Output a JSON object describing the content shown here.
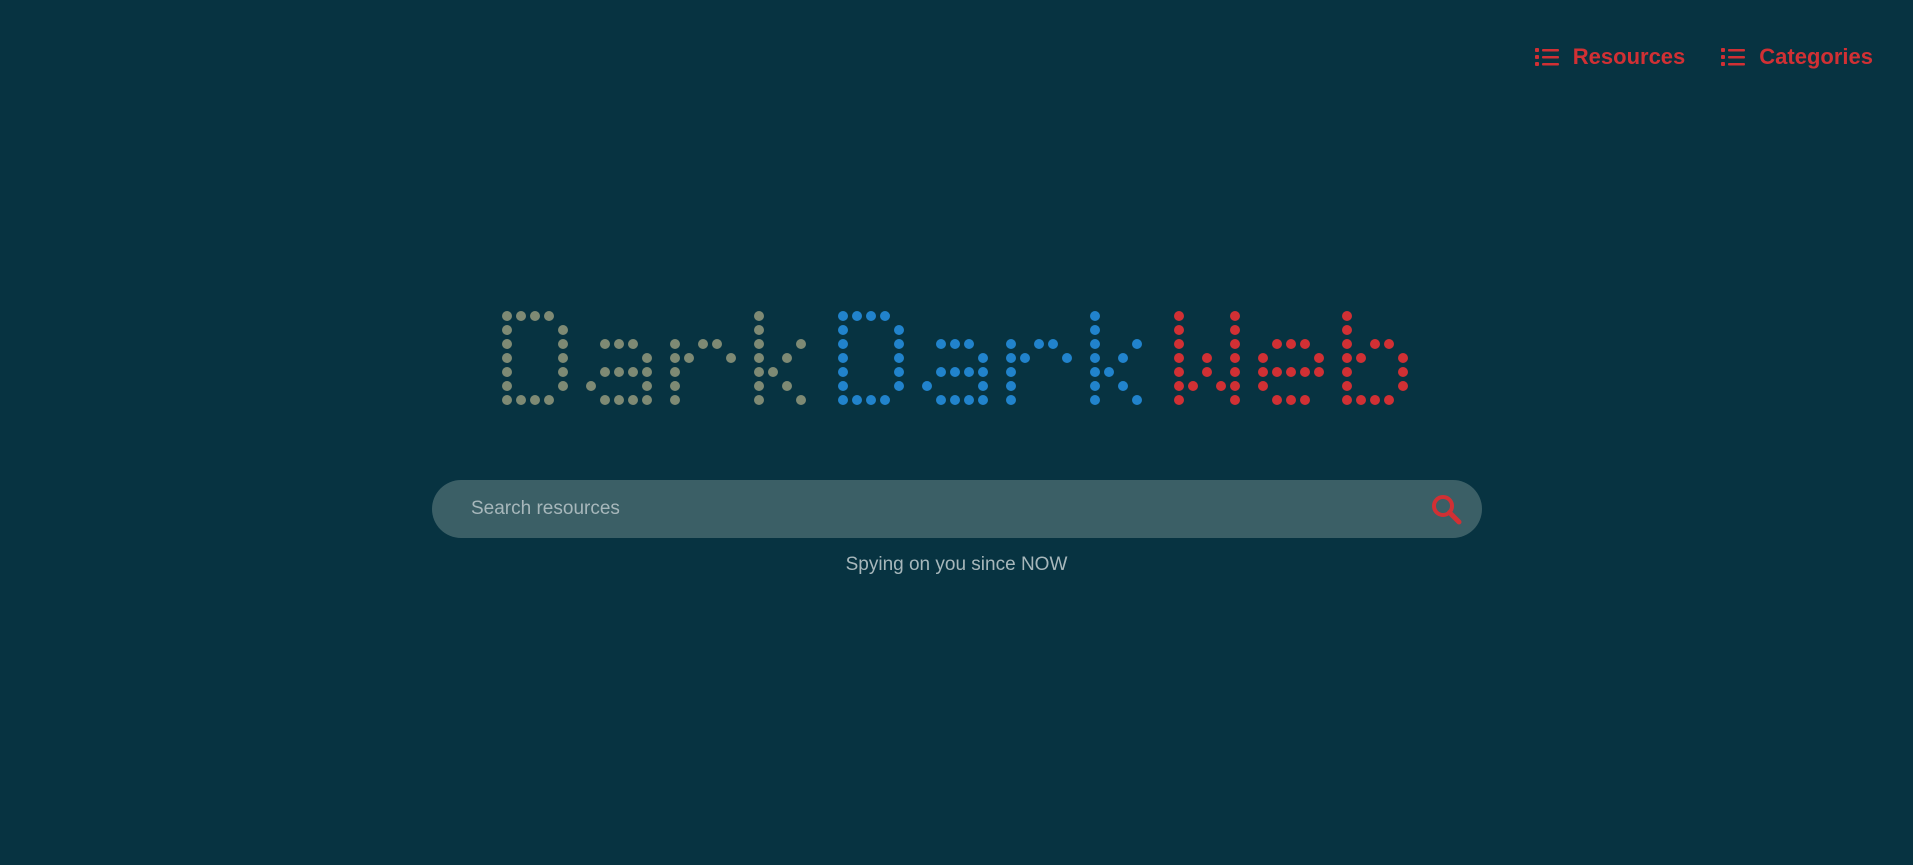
{
  "nav": {
    "resources": {
      "label": "Resources",
      "icon": "list-icon"
    },
    "categories": {
      "label": "Categories",
      "icon": "list-icon"
    }
  },
  "logo": {
    "segments": [
      {
        "text": "Dark",
        "color": "#7e8a74"
      },
      {
        "text": "Dark",
        "color": "#2183cc"
      },
      {
        "text": "Web",
        "color": "#d13034"
      }
    ]
  },
  "search": {
    "placeholder": "Search resources",
    "value": "",
    "icon": "search-icon"
  },
  "tagline": "Spying on you since NOW",
  "colors": {
    "background": "#073341",
    "accent": "#d13034",
    "search_bg": "#3b5f66"
  }
}
